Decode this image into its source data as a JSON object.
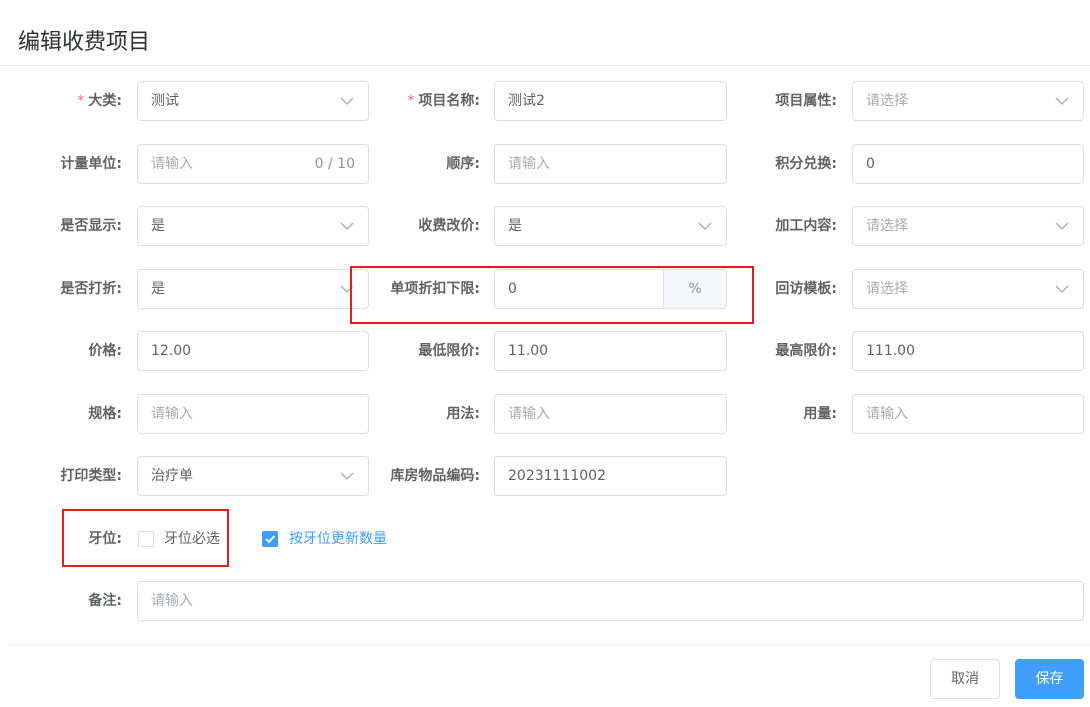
{
  "dialog": {
    "title": "编辑收费项目"
  },
  "form": {
    "category": {
      "label": "大类:",
      "value": "测试"
    },
    "item_name": {
      "label": "项目名称:",
      "value": "测试2"
    },
    "item_attr": {
      "label": "项目属性:",
      "placeholder": "请选择"
    },
    "unit": {
      "label": "计量单位:",
      "placeholder": "请输入",
      "counter": "0 / 10"
    },
    "order": {
      "label": "顺序:",
      "placeholder": "请输入"
    },
    "points": {
      "label": "积分兑换:",
      "value": "0"
    },
    "display": {
      "label": "是否显示:",
      "value": "是"
    },
    "price_edit": {
      "label": "收费改价:",
      "value": "是"
    },
    "process": {
      "label": "加工内容:",
      "placeholder": "请选择"
    },
    "discount": {
      "label": "是否打折:",
      "value": "是"
    },
    "discount_floor": {
      "label": "单项折扣下限:",
      "value": "0",
      "suffix": "%"
    },
    "followup": {
      "label": "回访模板:",
      "placeholder": "请选择"
    },
    "price": {
      "label": "价格:",
      "value": "12.00"
    },
    "min_price": {
      "label": "最低限价:",
      "value": "11.00"
    },
    "max_price": {
      "label": "最高限价:",
      "value": "111.00"
    },
    "spec": {
      "label": "规格:",
      "placeholder": "请输入"
    },
    "usage": {
      "label": "用法:",
      "placeholder": "请输入"
    },
    "dosage": {
      "label": "用量:",
      "placeholder": "请输入"
    },
    "print_type": {
      "label": "打印类型:",
      "value": "治疗单"
    },
    "warehouse_code": {
      "label": "库房物品编码:",
      "value": "20231111002"
    },
    "tooth": {
      "label": "牙位:",
      "required_label": "牙位必选",
      "required_checked": false,
      "update_label": "按牙位更新数量",
      "update_checked": true
    },
    "remark": {
      "label": "备注:",
      "placeholder": "请输入"
    }
  },
  "footer": {
    "cancel": "取消",
    "save": "保存"
  },
  "colors": {
    "primary": "#409eff",
    "required": "#f56c6c",
    "highlight": "#e02020"
  }
}
